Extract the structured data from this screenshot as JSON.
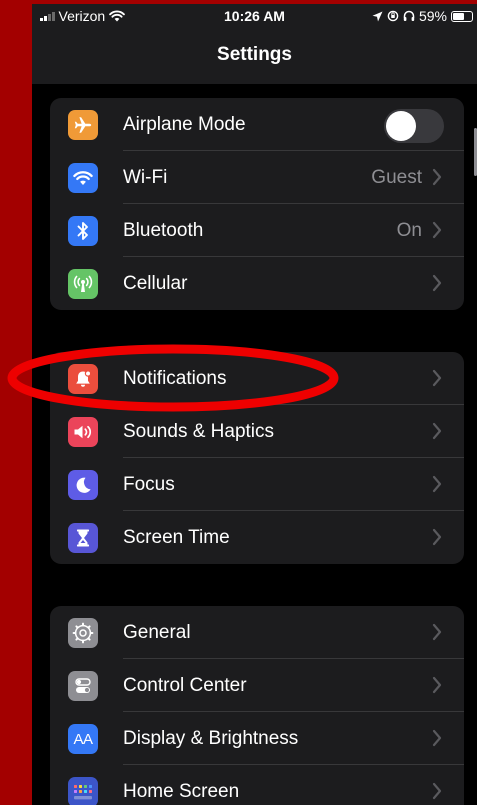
{
  "colors": {
    "frame_red": "#a30000",
    "annotation_red": "#ee0000",
    "chevron_gray": "#5a5a5e",
    "airplane_orange": "#f09a37",
    "wifi_blue": "#3478f6",
    "bluetooth_blue": "#3478f6",
    "cellular_green": "#65c466",
    "notifications_red": "#eb4e3d",
    "sounds_red": "#eb445a",
    "focus_purple": "#5e5ce6",
    "screen_time_purple": "#5856d6",
    "general_gray": "#8e8e93",
    "control_center_gray": "#8e8e93",
    "display_blue": "#3478f6",
    "home_screen_blue": "#3c55c8"
  },
  "status_bar": {
    "carrier": "Verizon",
    "time": "10:26 AM",
    "battery_percent": "59%",
    "battery_level": 0.59
  },
  "nav": {
    "title": "Settings"
  },
  "groups": [
    {
      "items": [
        {
          "label": "Airplane Mode",
          "value": "",
          "icon": "airplane-icon",
          "toggle": true,
          "toggle_on": false
        },
        {
          "label": "Wi-Fi",
          "value": "Guest",
          "icon": "wifi-icon"
        },
        {
          "label": "Bluetooth",
          "value": "On",
          "icon": "bluetooth-icon"
        },
        {
          "label": "Cellular",
          "value": "",
          "icon": "cellular-icon"
        }
      ]
    },
    {
      "items": [
        {
          "label": "Notifications",
          "value": "",
          "icon": "bell-icon"
        },
        {
          "label": "Sounds & Haptics",
          "value": "",
          "icon": "speaker-icon"
        },
        {
          "label": "Focus",
          "value": "",
          "icon": "moon-icon"
        },
        {
          "label": "Screen Time",
          "value": "",
          "icon": "hourglass-icon"
        }
      ]
    },
    {
      "items": [
        {
          "label": "General",
          "value": "",
          "icon": "gear-icon"
        },
        {
          "label": "Control Center",
          "value": "",
          "icon": "switches-icon"
        },
        {
          "label": "Display & Brightness",
          "value": "",
          "icon": "text-size-icon",
          "icon_text": "AA"
        },
        {
          "label": "Home Screen",
          "value": "",
          "icon": "app-grid-icon"
        }
      ]
    }
  ]
}
